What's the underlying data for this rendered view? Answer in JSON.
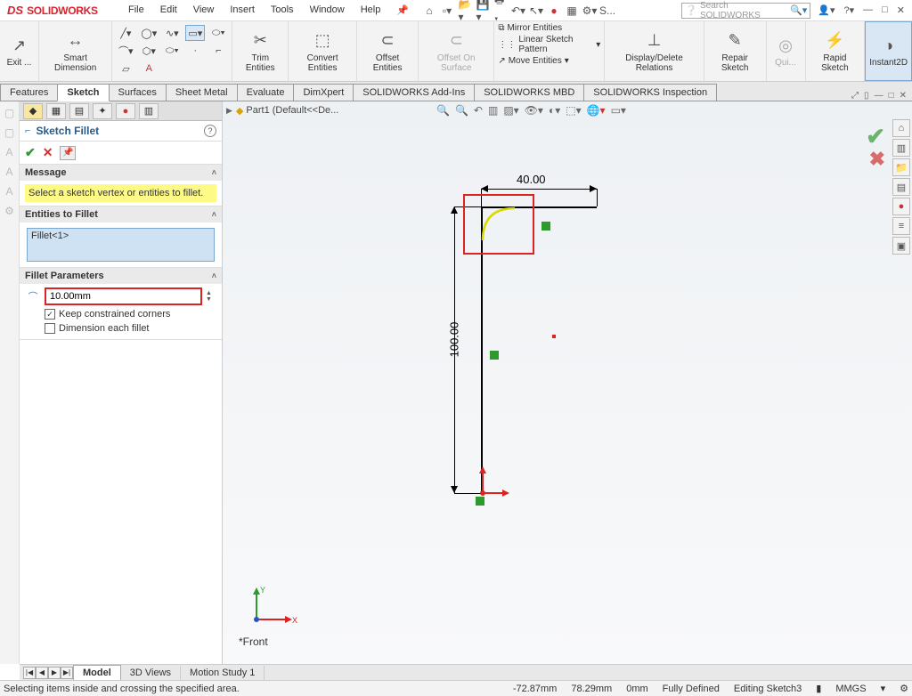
{
  "app": {
    "logo_prefix": "DS",
    "logo_text": "SOLIDWORKS",
    "menus": [
      "File",
      "Edit",
      "View",
      "Insert",
      "Tools",
      "Window",
      "Help"
    ],
    "search_placeholder": "Search SOLIDWORKS"
  },
  "ribbon": {
    "exit": "Exit ...",
    "smart_dim": "Smart Dimension",
    "trim": "Trim Entities",
    "convert": "Convert Entities",
    "offset": "Offset Entities",
    "offset_on": "Offset On Surface",
    "mirror": "Mirror Entities",
    "pattern": "Linear Sketch Pattern",
    "move": "Move Entities",
    "disprel": "Display/Delete Relations",
    "repair": "Repair Sketch",
    "quick": "Qui...",
    "rapid": "Rapid Sketch",
    "instant": "Instant2D"
  },
  "cmdtabs": [
    "Features",
    "Sketch",
    "Surfaces",
    "Sheet Metal",
    "Evaluate",
    "DimXpert",
    "SOLIDWORKS Add-Ins",
    "SOLIDWORKS MBD",
    "SOLIDWORKS Inspection"
  ],
  "active_cmdtab": 1,
  "tree": {
    "part": "Part1  (Default<<De..."
  },
  "pm": {
    "title": "Sketch Fillet",
    "msg_hdr": "Message",
    "msg": "Select a sketch vertex or entities to fillet.",
    "ent_hdr": "Entities to Fillet",
    "ent_item": "Fillet<1>",
    "param_hdr": "Fillet Parameters",
    "radius": "10.00mm",
    "keep": "Keep constrained corners",
    "dim_each": "Dimension each fillet"
  },
  "dims": {
    "h": "40.00",
    "v": "100.00"
  },
  "view_orient": "*Front",
  "btabs": [
    "Model",
    "3D Views",
    "Motion Study 1"
  ],
  "status": {
    "left": "Selecting items inside and crossing the specified area.",
    "x": "-72.87mm",
    "y": "78.29mm",
    "z": "0mm",
    "state": "Fully Defined",
    "editing": "Editing Sketch3",
    "units": "MMGS"
  }
}
